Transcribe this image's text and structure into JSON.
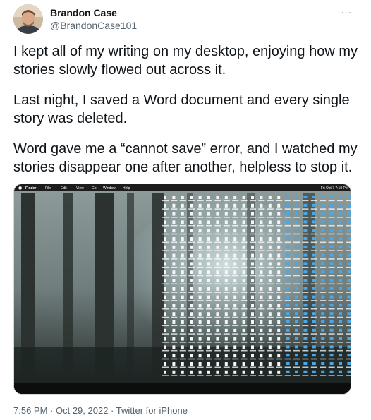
{
  "author": {
    "display_name": "Brandon Case",
    "handle": "@BrandonCase101",
    "avatar_icon": "profile-photo"
  },
  "more_icon": "ellipsis-icon",
  "more_label": "···",
  "tweet": {
    "paragraphs": [
      "I kept all of my writing on my desktop, enjoying how my stories slowly flowed out across it.",
      "Last night, I saved a Word document and every single story was deleted.",
      "Word gave me a “cannot save” error, and I watched my stories disappear one after another, helpless to stop it."
    ]
  },
  "media": {
    "description_icon": "desktop-screenshot-image",
    "menubar": {
      "apple_icon": "apple-logo-icon",
      "items": [
        "Finder",
        "File",
        "Edit",
        "View",
        "Go",
        "Window",
        "Help"
      ],
      "clock": "Fri Oct 7  7:10 PM"
    }
  },
  "meta": {
    "time": "7:56 PM",
    "separator": " · ",
    "date": "Oct 29, 2022",
    "source": "Twitter for iPhone"
  },
  "colors": {
    "text_primary": "#0f1419",
    "text_secondary": "#536471",
    "border": "#cfd9de",
    "folder_blue": "#4aa8e8"
  }
}
